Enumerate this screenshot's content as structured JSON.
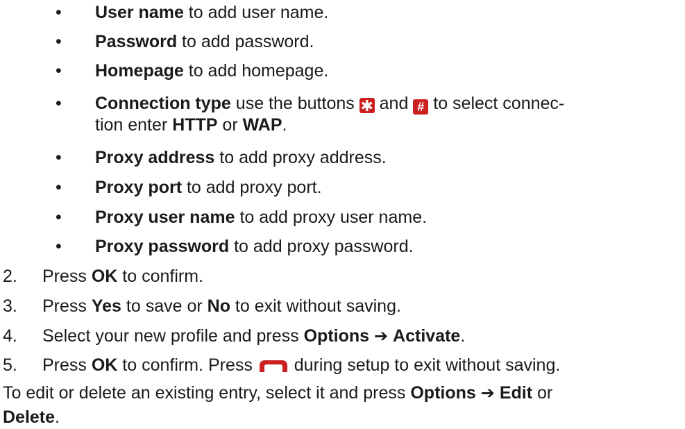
{
  "bullets": [
    {
      "term": "User name",
      "rest": " to add user name."
    },
    {
      "term": "Password",
      "rest": " to add password."
    },
    {
      "term": "Homepage",
      "rest": " to add homepage."
    },
    {
      "term": "Connection type",
      "rest_a": " use the buttons ",
      "key1": "✱",
      "rest_b": " and ",
      "key2": "#",
      "rest_c": " to select connec-",
      "line2_a": "tion enter ",
      "http": "HTTP",
      "line2_b": " or ",
      "wap": "WAP",
      "line2_c": "."
    },
    {
      "term": "Proxy address",
      "rest": " to add proxy address."
    },
    {
      "term": "Proxy port",
      "rest": " to add proxy port."
    },
    {
      "term": "Proxy user name",
      "rest": " to add proxy user name."
    },
    {
      "term": "Proxy password",
      "rest": " to add proxy password."
    }
  ],
  "bullet_symbol": "•",
  "steps": [
    {
      "num": "2.",
      "a": "Press ",
      "b1": "OK",
      "c": " to confirm."
    },
    {
      "num": "3.",
      "a": "Press ",
      "b1": "Yes",
      "c": " to save or ",
      "b2": "No",
      "d": " to exit without saving."
    },
    {
      "num": "4.",
      "a": "Select your new profile and press ",
      "b1": "Options",
      "arrow": "➔",
      "b2": "Activate",
      "d": "."
    },
    {
      "num": "5.",
      "a": "Press ",
      "b1": "OK",
      "c": " to confirm. Press ",
      "d": " during setup to exit without saving.",
      "key_icon": "end-call-key-icon"
    }
  ],
  "footer": {
    "a": "To edit or delete an existing entry, select it and press ",
    "b1": "Options",
    "arrow": "➔",
    "b2": "Edit",
    "c": " or",
    "b3": "Delete",
    "d": "."
  },
  "colors": {
    "accent": "#cc1f1f",
    "text": "#1a1a1a"
  }
}
